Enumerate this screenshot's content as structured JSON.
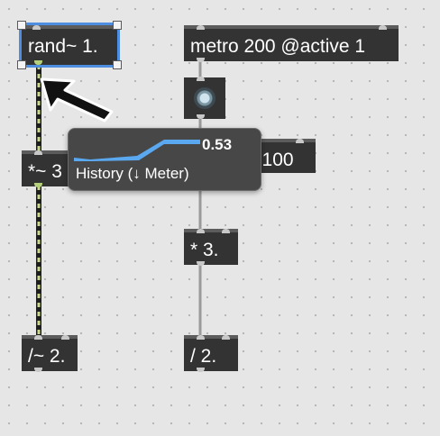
{
  "objects": {
    "rand": "rand~ 1.",
    "metro": "metro 200 @active 1",
    "mul_sig": "*~ 3",
    "line": "n 100",
    "mul": "* 3.",
    "div_sig": "/~ 2.",
    "div": "/ 2."
  },
  "probe": {
    "value": "0.53",
    "caption": "History (↓ Meter)",
    "level": 0.53
  },
  "colors": {
    "canvas": "#e6e6e6",
    "object_fill": "#333333",
    "selection": "#4d8ee0",
    "history_line": "#5aa8f0",
    "signal_cord_stripe": "#c9d98a",
    "control_cord": "#9a9a9a"
  },
  "icons": [
    "toggle-icon",
    "mouse-pointer-icon"
  ]
}
